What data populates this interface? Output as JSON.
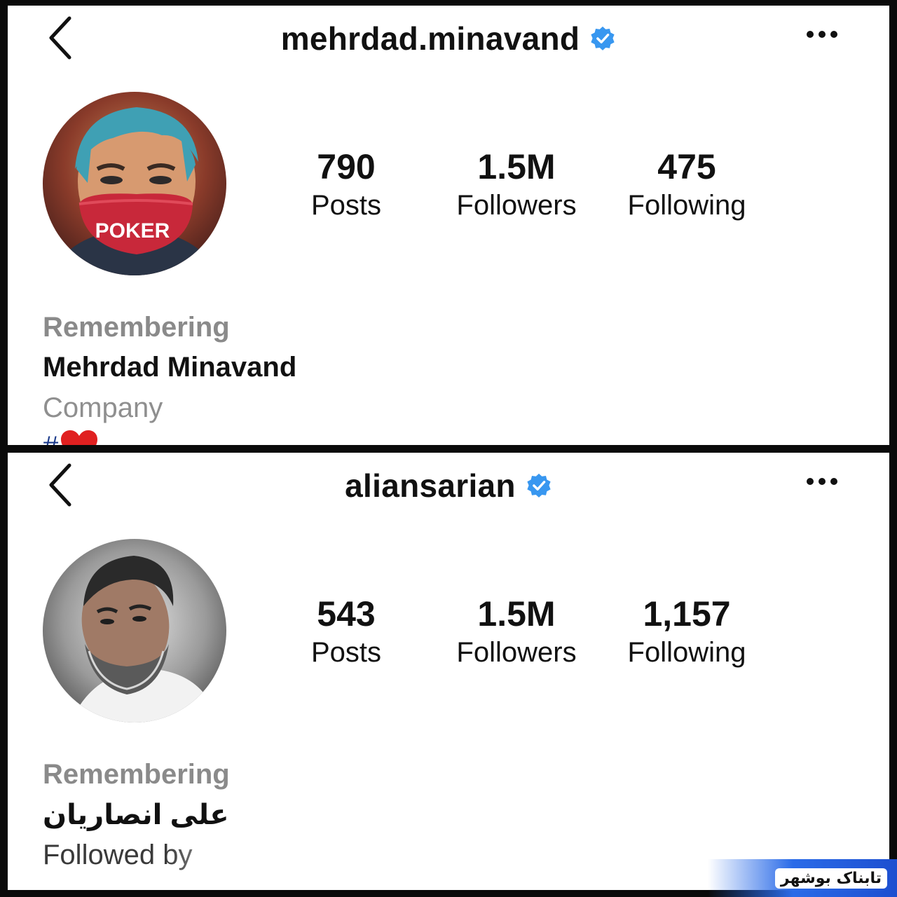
{
  "profiles": [
    {
      "username": "mehrdad.minavand",
      "verified": true,
      "stats": [
        {
          "value": "790",
          "label": "Posts"
        },
        {
          "value": "1.5M",
          "label": "Followers"
        },
        {
          "value": "475",
          "label": "Following"
        }
      ],
      "bio": {
        "category": "Remembering",
        "name": "Mehrdad Minavand",
        "extra": "Company",
        "tag": "#"
      },
      "avatar_mask_text": "POKER"
    },
    {
      "username": "aliansarian",
      "verified": true,
      "stats": [
        {
          "value": "543",
          "label": "Posts"
        },
        {
          "value": "1.5M",
          "label": "Followers"
        },
        {
          "value": "1,157",
          "label": "Following"
        }
      ],
      "bio": {
        "category": "Remembering",
        "name": "علی انصاریان",
        "extra": "Followed by"
      }
    }
  ],
  "icons": {
    "back": "chevron-left-icon",
    "verified": "verified-badge-icon",
    "more": "more-horizontal-icon",
    "heart": "red-heart-icon"
  },
  "colors": {
    "verified_blue": "#3897f0",
    "category_gray": "#8a8a8a",
    "watermark_blue": "#1d4fd0"
  },
  "watermark": "تابناک بوشهر"
}
